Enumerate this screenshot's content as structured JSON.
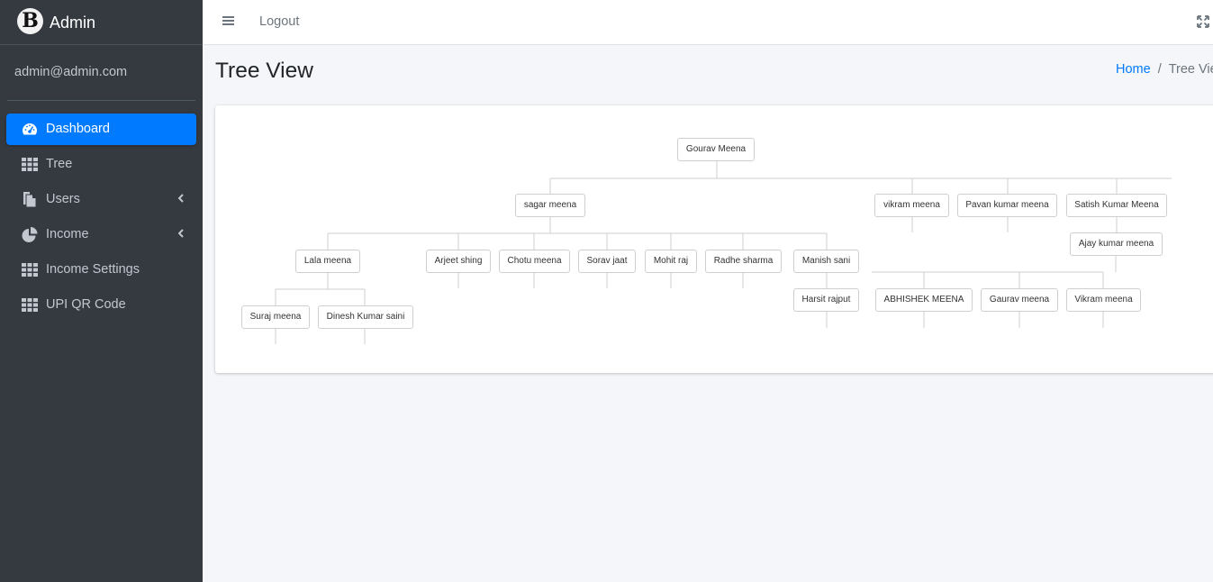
{
  "brand": {
    "logo_letter": "B",
    "name": "Admin"
  },
  "user": {
    "email": "admin@admin.com"
  },
  "sidebar": {
    "items": [
      {
        "label": "Dashboard",
        "icon": "tachometer-icon",
        "active": true,
        "has_submenu": false
      },
      {
        "label": "Tree",
        "icon": "table-icon",
        "active": false,
        "has_submenu": false
      },
      {
        "label": "Users",
        "icon": "copy-icon",
        "active": false,
        "has_submenu": true
      },
      {
        "label": "Income",
        "icon": "pie-chart-icon",
        "active": false,
        "has_submenu": true
      },
      {
        "label": "Income Settings",
        "icon": "table-icon",
        "active": false,
        "has_submenu": false
      },
      {
        "label": "UPI QR Code",
        "icon": "table-icon",
        "active": false,
        "has_submenu": false
      }
    ]
  },
  "topbar": {
    "menu_icon": "bars-icon",
    "logout_label": "Logout",
    "fullscreen_icon": "expand-icon"
  },
  "page": {
    "title": "Tree View"
  },
  "breadcrumb": {
    "home": "Home",
    "separator": "/",
    "current": "Tree View"
  },
  "colors": {
    "sidebar_bg": "#343a40",
    "active_item": "#007bff",
    "content_bg": "#f4f6f9"
  },
  "tree": {
    "nodes": {
      "gourav": "Gourav Meena",
      "sagar": "sagar meena",
      "vikram1": "vikram meena",
      "pavan": "Pavan kumar meena",
      "satish": "Satish Kumar Meena",
      "lala": "Lala meena",
      "arjeet": "Arjeet shing",
      "chotu": "Chotu meena",
      "sorav": "Sorav jaat",
      "mohit": "Mohit raj",
      "radhe": "Radhe sharma",
      "manish": "Manish sani",
      "ajay": "Ajay kumar meena",
      "suraj": "Suraj meena",
      "dinesh": "Dinesh Kumar saini",
      "harsit": "Harsit rajput",
      "abhishek": "ABHISHEK MEENA",
      "gaurav2": "Gaurav meena",
      "vikram2": "Vikram meena"
    }
  }
}
